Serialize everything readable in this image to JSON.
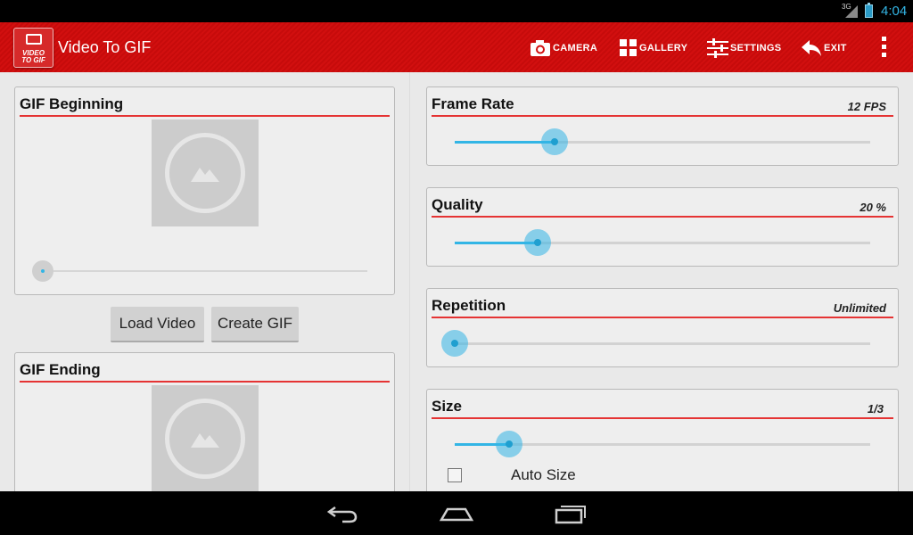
{
  "status": {
    "network": "3G",
    "time": "4:04"
  },
  "app": {
    "title": "Video To GIF",
    "logo_text_1": "VIDEO",
    "logo_text_2": "TO GIF"
  },
  "actions": [
    {
      "label": "CAMERA",
      "icon": "camera-icon"
    },
    {
      "label": "GALLERY",
      "icon": "grid-icon"
    },
    {
      "label": "SETTINGS",
      "icon": "sliders-icon"
    },
    {
      "label": "EXIT",
      "icon": "reply-arrow-icon"
    }
  ],
  "left": {
    "begin": {
      "title": "GIF Beginning",
      "seek_position": 0
    },
    "buttons": {
      "load": "Load Video",
      "create": "Create GIF"
    },
    "end": {
      "title": "GIF Ending"
    }
  },
  "settings": {
    "frame_rate": {
      "title": "Frame Rate",
      "value": "12 FPS",
      "level": 0.24
    },
    "quality": {
      "title": "Quality",
      "value": "20 %",
      "level": 0.2
    },
    "repetition": {
      "title": "Repetition",
      "value": "Unlimited",
      "level": 0
    },
    "size": {
      "title": "Size",
      "value": "1/3",
      "level": 0.13,
      "auto_size_label": "Auto Size",
      "auto_size_checked": false
    }
  },
  "colors": {
    "action_bar": "#d20f0f",
    "accent": "#33b5e5",
    "underline": "#e53333"
  },
  "nav": {
    "back_icon": "back-icon",
    "home_icon": "home-icon",
    "recents_icon": "recents-icon"
  }
}
